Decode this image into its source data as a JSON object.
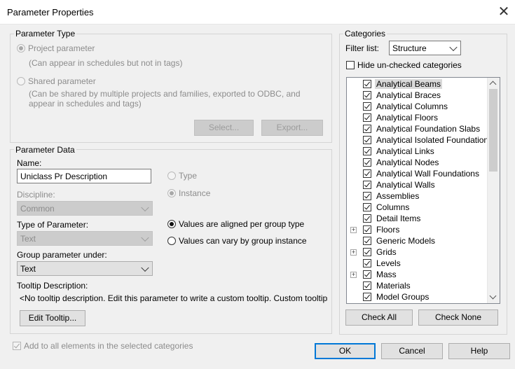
{
  "window": {
    "title": "Parameter Properties"
  },
  "parameter_type": {
    "heading": "Parameter Type",
    "project": {
      "label": "Project parameter",
      "hint": "(Can appear in schedules but not in tags)"
    },
    "shared": {
      "label": "Shared parameter",
      "hint_line1": "(Can be shared by multiple projects and families, exported to ODBC, and",
      "hint_line2": "appear in schedules and tags)"
    },
    "select_label": "Select...",
    "export_label": "Export..."
  },
  "parameter_data": {
    "heading": "Parameter Data",
    "name_label": "Name:",
    "name_value": "Uniclass Pr Description",
    "discipline_label": "Discipline:",
    "discipline_value": "Common",
    "type_label": "Type of Parameter:",
    "type_value": "Text",
    "group_label": "Group parameter under:",
    "group_value": "Text",
    "type_radio": "Type",
    "instance_radio": "Instance",
    "aligned_radio": "Values are aligned per group type",
    "vary_radio": "Values can vary by group instance",
    "tooltip_label": "Tooltip Description:",
    "tooltip_text": "<No tooltip description. Edit this parameter to write a custom tooltip. Custom tooltips hav...",
    "edit_tooltip_label": "Edit Tooltip..."
  },
  "add_all_label": "Add to all elements in the selected categories",
  "categories": {
    "heading": "Categories",
    "filter_label": "Filter list:",
    "filter_value": "Structure",
    "hide_label": "Hide un-checked categories",
    "items": [
      {
        "label": "Analytical Beams",
        "expandable": false
      },
      {
        "label": "Analytical Braces",
        "expandable": false
      },
      {
        "label": "Analytical Columns",
        "expandable": false
      },
      {
        "label": "Analytical Floors",
        "expandable": false
      },
      {
        "label": "Analytical Foundation Slabs",
        "expandable": false
      },
      {
        "label": "Analytical Isolated Foundations",
        "expandable": false
      },
      {
        "label": "Analytical Links",
        "expandable": false
      },
      {
        "label": "Analytical Nodes",
        "expandable": false
      },
      {
        "label": "Analytical Wall Foundations",
        "expandable": false
      },
      {
        "label": "Analytical Walls",
        "expandable": false
      },
      {
        "label": "Assemblies",
        "expandable": false
      },
      {
        "label": "Columns",
        "expandable": false
      },
      {
        "label": "Detail Items",
        "expandable": false
      },
      {
        "label": "Floors",
        "expandable": true
      },
      {
        "label": "Generic Models",
        "expandable": false
      },
      {
        "label": "Grids",
        "expandable": true
      },
      {
        "label": "Levels",
        "expandable": false
      },
      {
        "label": "Mass",
        "expandable": true
      },
      {
        "label": "Materials",
        "expandable": false
      },
      {
        "label": "Model Groups",
        "expandable": false
      }
    ],
    "check_all_label": "Check All",
    "check_none_label": "Check None"
  },
  "footer": {
    "ok_label": "OK",
    "cancel_label": "Cancel",
    "help_label": "Help"
  }
}
